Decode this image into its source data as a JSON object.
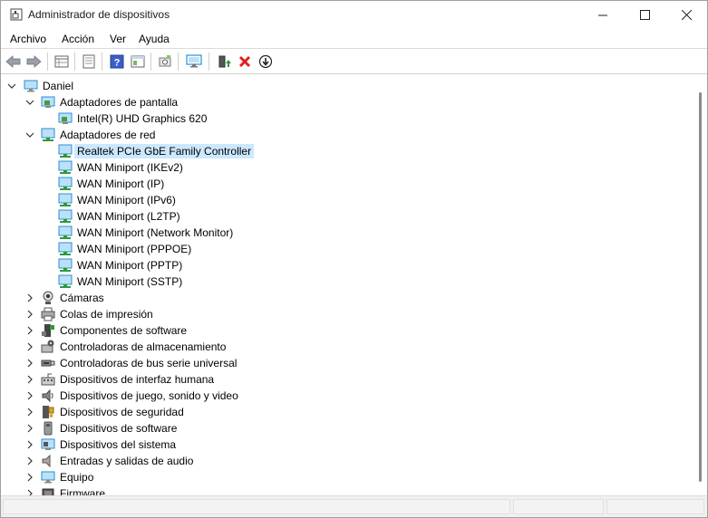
{
  "window": {
    "title": "Administrador de dispositivos",
    "minimize_icon": "minimize-icon",
    "maximize_icon": "maximize-icon",
    "close_icon": "close-icon"
  },
  "menu": {
    "items": [
      "Archivo",
      "Acción",
      "Ver",
      "Ayuda"
    ]
  },
  "toolbar": {
    "buttons": [
      "back-arrow-icon",
      "forward-arrow-icon",
      "properties-grid-icon",
      "document-icon",
      "help-icon",
      "view-icon",
      "scan-hardware-icon",
      "monitor-icon",
      "update-driver-icon",
      "uninstall-icon",
      "disable-icon"
    ]
  },
  "tree": {
    "root": "Daniel",
    "categories": [
      {
        "label": "Adaptadores de pantalla",
        "expanded": true,
        "icon": "display-adapter-icon",
        "children": [
          "Intel(R) UHD Graphics 620"
        ]
      },
      {
        "label": "Adaptadores de red",
        "expanded": true,
        "icon": "network-adapter-icon",
        "children": [
          "Realtek PCIe GbE Family Controller",
          "WAN Miniport (IKEv2)",
          "WAN Miniport (IP)",
          "WAN Miniport (IPv6)",
          "WAN Miniport (L2TP)",
          "WAN Miniport (Network Monitor)",
          "WAN Miniport (PPPOE)",
          "WAN Miniport (PPTP)",
          "WAN Miniport (SSTP)"
        ]
      },
      {
        "label": "Cámaras",
        "expanded": false,
        "icon": "camera-icon"
      },
      {
        "label": "Colas de impresión",
        "expanded": false,
        "icon": "printer-icon"
      },
      {
        "label": "Componentes de software",
        "expanded": false,
        "icon": "software-component-icon"
      },
      {
        "label": "Controladoras de almacenamiento",
        "expanded": false,
        "icon": "storage-controller-icon"
      },
      {
        "label": "Controladoras de bus serie universal",
        "expanded": false,
        "icon": "usb-icon"
      },
      {
        "label": "Dispositivos de interfaz humana",
        "expanded": false,
        "icon": "hid-icon"
      },
      {
        "label": "Dispositivos de juego, sonido y video",
        "expanded": false,
        "icon": "speaker-icon"
      },
      {
        "label": "Dispositivos de seguridad",
        "expanded": false,
        "icon": "security-device-icon"
      },
      {
        "label": "Dispositivos de software",
        "expanded": false,
        "icon": "software-device-icon"
      },
      {
        "label": "Dispositivos del sistema",
        "expanded": false,
        "icon": "system-device-icon"
      },
      {
        "label": "Entradas y salidas de audio",
        "expanded": false,
        "icon": "audio-io-icon"
      },
      {
        "label": "Equipo",
        "expanded": false,
        "icon": "computer-icon"
      },
      {
        "label": "Firmware",
        "expanded": false,
        "icon": "firmware-icon"
      }
    ],
    "selected": "Realtek PCIe GbE Family Controller"
  },
  "colors": {
    "selection": "#cce8ff",
    "monitor_blue": "#2a8fd6",
    "uninstall_red": "#e0201b",
    "update_green": "#2e9a3a"
  }
}
